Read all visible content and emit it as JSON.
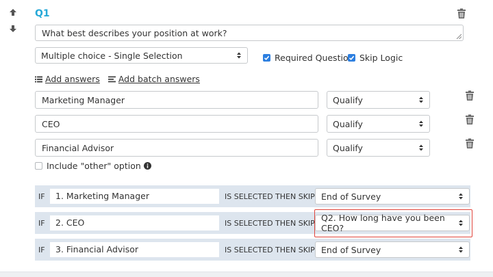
{
  "question": {
    "number": "Q1",
    "text": "What best describes your position at work?",
    "type_selected": "Multiple choice - Single Selection",
    "required_label": "Required Question",
    "skip_logic_label": "Skip Logic"
  },
  "actions": {
    "add_answers": "Add answers",
    "add_batch_answers": "Add batch answers"
  },
  "answers": [
    {
      "text": "Marketing Manager",
      "type": "Qualify"
    },
    {
      "text": "CEO",
      "type": "Qualify"
    },
    {
      "text": "Financial Advisor",
      "type": "Qualify"
    }
  ],
  "other_option_label": "Include \"other\" option",
  "logic": {
    "if_label": "IF",
    "mid_label": "IS SELECTED THEN SKIP TO",
    "rows": [
      {
        "condition": "1. Marketing Manager",
        "destination": "End of Survey"
      },
      {
        "condition": "2. CEO",
        "destination": "Q2. How long have you been CEO?"
      },
      {
        "condition": "3. Financial Advisor",
        "destination": "End of Survey"
      }
    ]
  },
  "colors": {
    "accent": "#27a9d8",
    "checkbox": "#2d7fe0",
    "logic_bg": "#dde5ee",
    "highlight": "#e0453c"
  }
}
